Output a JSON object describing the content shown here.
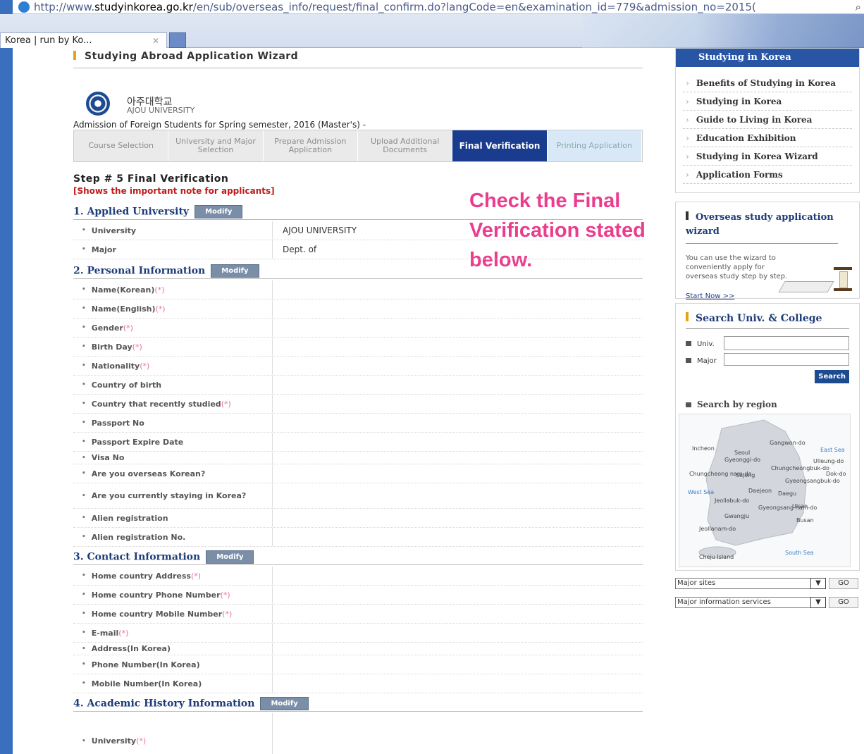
{
  "browser": {
    "url_prefix": "http://www.",
    "url_host": "studyinkorea.go.kr",
    "url_rest": "/en/sub/overseas_info/request/final_confirm.do?langCode=en&examination_id=779&admission_no=2015(",
    "tab_title": "Korea | run by Ko...",
    "tab_close": "✕",
    "search_icon": "⌕"
  },
  "wizard": {
    "title": "Studying Abroad Application Wizard",
    "univ_ko": "아주대학교",
    "univ_en": "AJOU UNIVERSITY",
    "admission": "Admission of Foreign Students for Spring semester, 2016 (Master's) -",
    "steps": [
      {
        "label": "Course Selection",
        "state": "done"
      },
      {
        "label": "University and Major Selection",
        "state": "done"
      },
      {
        "label": "Prepare Admission Application",
        "state": "done"
      },
      {
        "label": "Upload Additional Documents",
        "state": "done"
      },
      {
        "label": "Final Verification",
        "state": "active"
      },
      {
        "label": "Printing Application",
        "state": "todo"
      }
    ],
    "step_title": "Step # 5 Final Verification",
    "step_note": "[Shows the important note for applicants]"
  },
  "annotation": "Check the Final Verification stated below.",
  "modify_label": "Modify",
  "required_mark": "(*)",
  "sections": {
    "applied": {
      "title": "1. Applied University",
      "rows": [
        {
          "label": "University",
          "value": "AJOU UNIVERSITY"
        },
        {
          "label": "Major",
          "value": "Dept. of"
        }
      ]
    },
    "personal": {
      "title": "2. Personal Information",
      "rows": [
        {
          "label": "Name(Korean)",
          "req": true
        },
        {
          "label": "Name(English)",
          "req": true
        },
        {
          "label": "Gender",
          "req": true
        },
        {
          "label": "Birth Day",
          "req": true
        },
        {
          "label": "Nationality",
          "req": true
        },
        {
          "label": "Country of birth",
          "req": false
        },
        {
          "label": "Country that recently studied",
          "req": true
        },
        {
          "label": "Passport No",
          "req": false
        },
        {
          "label": "Passport Expire Date",
          "req": false
        },
        {
          "label": "Visa No",
          "req": false
        },
        {
          "label": "Are you overseas Korean?",
          "req": false
        },
        {
          "label": "Are you currently staying in Korea?",
          "req": false
        },
        {
          "label": "Alien registration",
          "req": false
        },
        {
          "label": "Alien registration No.",
          "req": false
        }
      ]
    },
    "contact": {
      "title": "3. Contact Information",
      "rows": [
        {
          "label": "Home country Address",
          "req": true
        },
        {
          "label": "Home country Phone Number",
          "req": true
        },
        {
          "label": "Home country Mobile Number",
          "req": true
        },
        {
          "label": "E-mail",
          "req": true
        },
        {
          "label": "Address(In Korea)",
          "req": false
        },
        {
          "label": "Phone Number(In Korea)",
          "req": false
        },
        {
          "label": "Mobile Number(In Korea)",
          "req": false
        }
      ]
    },
    "academic": {
      "title": "4. Academic History Information",
      "rows": [
        {
          "label": "University",
          "req": true
        }
      ]
    }
  },
  "sidebar": {
    "head": "Studying in Korea",
    "items": [
      "Benefits of Studying in Korea",
      "Studying in Korea",
      "Guide to Living in Korea",
      "Education Exhibition",
      "Studying in Korea Wizard",
      "Application Forms"
    ],
    "overseas_title": "Overseas study application wizard",
    "overseas_desc": "You can use the wizard to conveniently apply for overseas study step by step.",
    "start_now": "Start Now >>",
    "search_title": "Search Univ. & College",
    "univ_label": "Univ.",
    "major_label": "Major",
    "search_btn": "Search",
    "region_title": "Search by region",
    "map_labels": [
      "Incheon",
      "Seoul",
      "Gangwon-do",
      "East Sea",
      "Gyeonggi-do",
      "Ulleung-do",
      "Chungcheongbuk-do",
      "Chungcheong nam-do",
      "Sejong",
      "Dok-do",
      "Gyeongsangbuk-do",
      "West Sea",
      "Daejeon",
      "Daegu",
      "Jeollabuk-do",
      "Ulsan",
      "Gyeongsang nam-do",
      "Gwangju",
      "Busan",
      "Jeollanam-do",
      "South Sea",
      "Cheju Island"
    ],
    "major_sites": "Major sites",
    "major_info": "Major information services",
    "go": "GO"
  }
}
